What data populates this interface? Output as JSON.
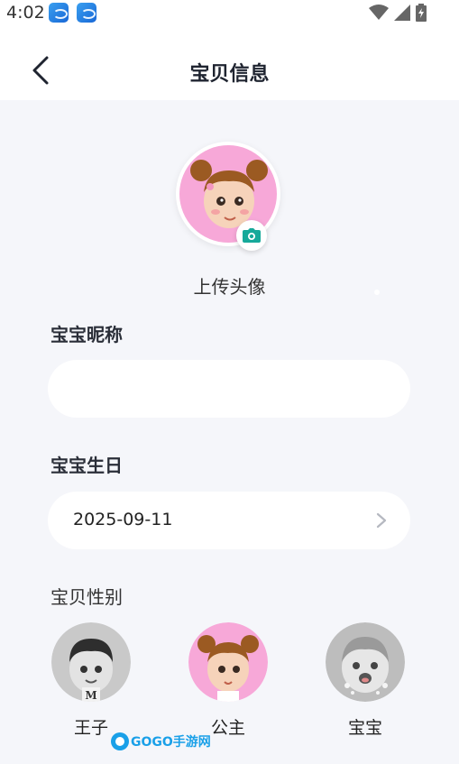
{
  "status_bar": {
    "time": "4:02"
  },
  "header": {
    "title": "宝贝信息"
  },
  "avatar": {
    "upload_label": "上传头像"
  },
  "nickname": {
    "label": "宝宝昵称",
    "value": "",
    "placeholder": ""
  },
  "birthday": {
    "label": "宝宝生日",
    "value": "2025-09-11"
  },
  "gender": {
    "title": "宝贝性别",
    "options": [
      {
        "label": "王子"
      },
      {
        "label": "公主"
      },
      {
        "label": "宝宝"
      }
    ]
  },
  "watermark": {
    "text": "GOGO手游网"
  },
  "colors": {
    "accent": "#16a99a",
    "background": "#f5f6fa",
    "pink": "#f7a8d8"
  }
}
